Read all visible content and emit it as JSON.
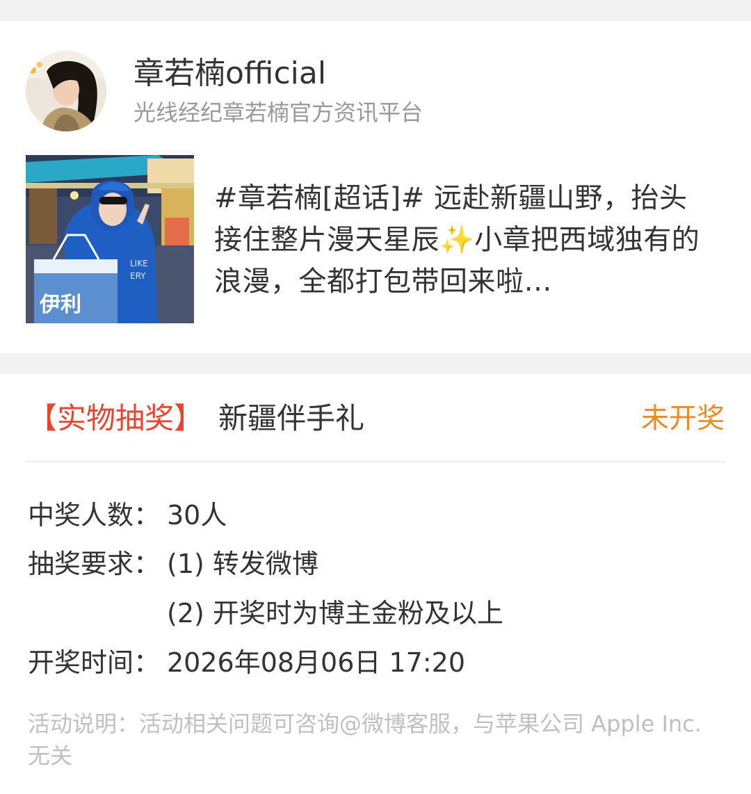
{
  "author": {
    "name": "章若楠official",
    "description": "光线经纪章若楠官方资讯平台",
    "avatar_icon": "avatar-photo"
  },
  "post": {
    "image_icon": "post-photo",
    "text": "#章若楠[超话]# 远赴新疆山野，抬头接住整片漫天星辰✨小章把西域独有的浪漫，全都打包带回来啦…",
    "image_caption": "伊利"
  },
  "lottery": {
    "tag": "【实物抽奖】",
    "title": "新疆伴手礼",
    "status": "未开奖",
    "winners_label": "中奖人数：",
    "winners_value": "30人",
    "requirements_label": "抽奖要求：",
    "requirement_1": "(1) 转发微博",
    "requirement_2": "(2) 开奖时为博主金粉及以上",
    "draw_time_label": "开奖时间：",
    "draw_time_value": "2026年08月06日 17:20",
    "note": "活动说明：活动相关问题可咨询@微博客服，与苹果公司 Apple Inc. 无关"
  },
  "colors": {
    "tag": "#e8452f",
    "status": "#f08a22",
    "secondary_text": "#999999",
    "note_text": "#c0c0c0",
    "background": "#f2f2f2"
  }
}
